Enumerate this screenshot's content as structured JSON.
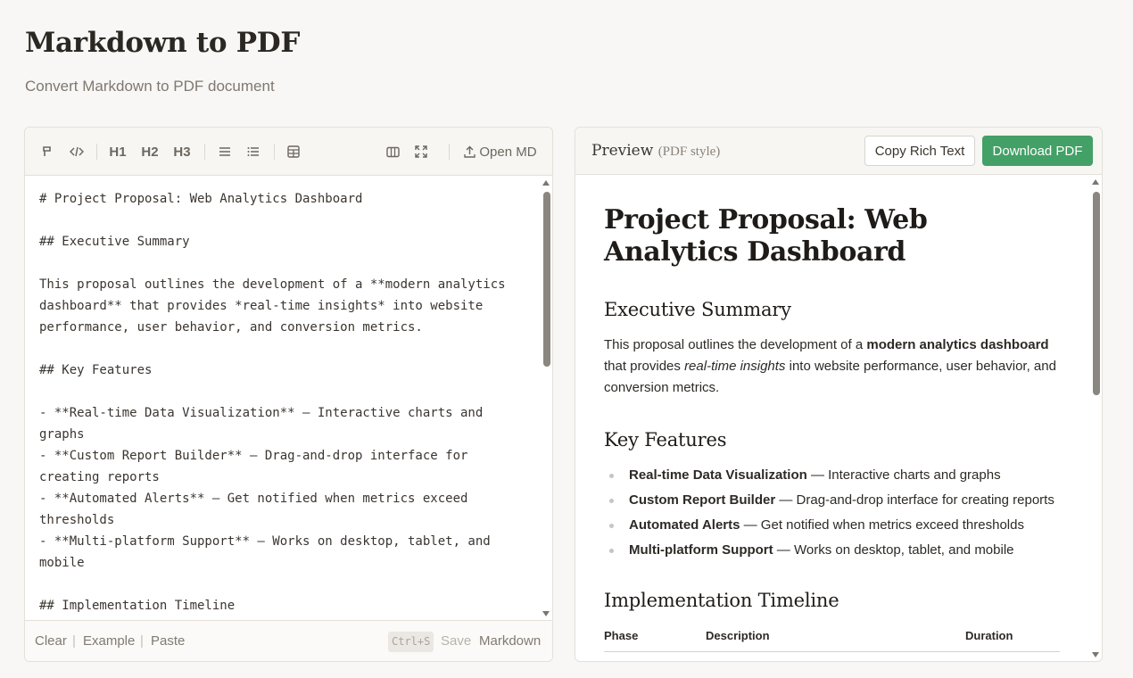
{
  "app": {
    "title": "Markdown to PDF",
    "subtitle": "Convert Markdown to PDF document"
  },
  "toolbar": {
    "h1": "H1",
    "h2": "H2",
    "h3": "H3",
    "open_md": "Open MD"
  },
  "editor": {
    "content": "# Project Proposal: Web Analytics Dashboard\n\n## Executive Summary\n\nThis proposal outlines the development of a **modern analytics dashboard** that provides *real-time insights* into website performance, user behavior, and conversion metrics.\n\n## Key Features\n\n- **Real-time Data Visualization** — Interactive charts and graphs\n- **Custom Report Builder** — Drag-and-drop interface for creating reports\n- **Automated Alerts** — Get notified when metrics exceed thresholds\n- **Multi-platform Support** — Works on desktop, tablet, and mobile\n\n## Implementation Timeline"
  },
  "footer": {
    "clear": "Clear",
    "example": "Example",
    "paste": "Paste",
    "shortcut": "Ctrl+S",
    "save": "Save",
    "mode": "Markdown",
    "separator": "|"
  },
  "preview": {
    "title": "Preview",
    "title_sub": "(PDF style)",
    "copy_button": "Copy Rich Text",
    "download_button": "Download PDF",
    "h1": "Project Proposal: Web Analytics Dashboard",
    "h2_summary": "Executive Summary",
    "p1_a": "This proposal outlines the development of a ",
    "p1_b": "modern analytics dashboard",
    "p1_c": " that provides ",
    "p1_d": "real-time insights",
    "p1_e": " into website performance, user behavior, and conversion metrics.",
    "h2_features": "Key Features",
    "features": [
      {
        "title": "Real-time Data Visualization",
        "desc": " — Interactive charts and graphs"
      },
      {
        "title": "Custom Report Builder",
        "desc": " — Drag-and-drop interface for creating reports"
      },
      {
        "title": "Automated Alerts",
        "desc": " — Get notified when metrics exceed thresholds"
      },
      {
        "title": "Multi-platform Support",
        "desc": " — Works on desktop, tablet, and mobile"
      }
    ],
    "h2_timeline": "Implementation Timeline",
    "table_headers": [
      "Phase",
      "Description",
      "Duration"
    ]
  },
  "colors": {
    "accent": "#43a066",
    "background": "#f8f7f5",
    "scrollbar": "#8a8680"
  }
}
